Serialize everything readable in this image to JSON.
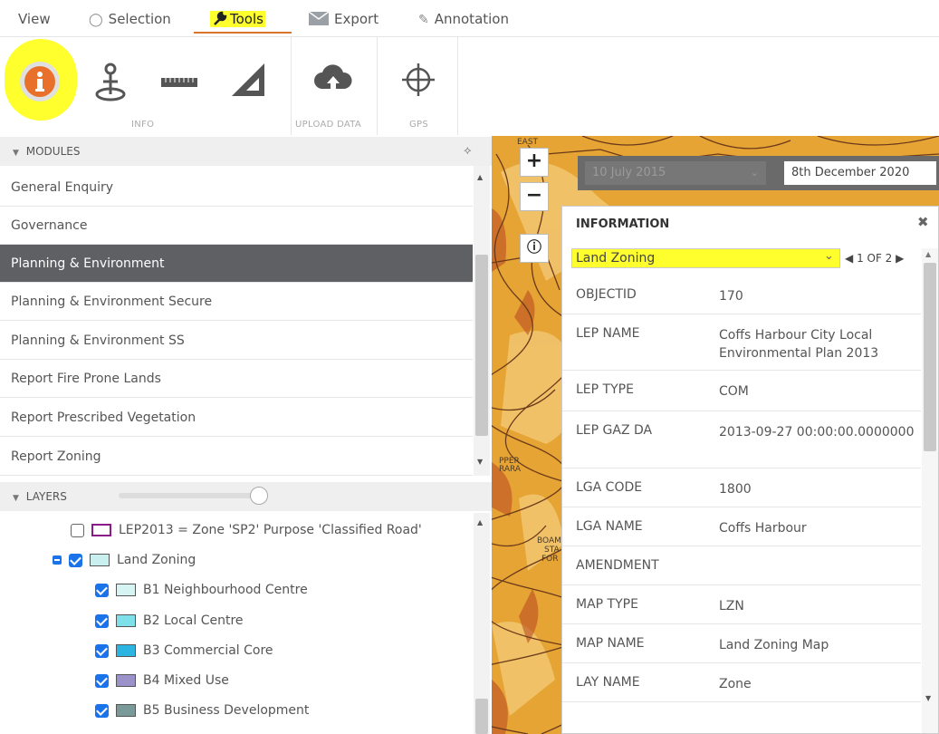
{
  "menu": {
    "view": "View",
    "selection": "Selection",
    "tools": "Tools",
    "export": "Export",
    "annotation": "Annotation"
  },
  "ribbon": {
    "info_label": "INFO",
    "upload_label": "UPLOAD DATA",
    "gps_label": "GPS"
  },
  "modules": {
    "header": "MODULES",
    "items": [
      "General Enquiry",
      "Governance",
      "Planning & Environment",
      "Planning & Environment Secure",
      "Planning & Environment SS",
      "Report Fire Prone Lands",
      "Report Prescribed Vegetation",
      "Report Zoning"
    ],
    "active": "Planning & Environment"
  },
  "layers": {
    "header": "LAYERS",
    "opacity_percent": 100,
    "items": [
      {
        "label": "LEP2013 = Zone 'SP2' Purpose 'Classified Road'",
        "checked": false,
        "swatch": "#ffffff",
        "border": "#8b1a8b"
      },
      {
        "label": "Land Zoning",
        "checked": true,
        "swatch": "#c9f0ee",
        "border": "#555555"
      },
      {
        "label": "B1 Neighbourhood Centre",
        "checked": true,
        "swatch": "#d6f5f2",
        "border": "#555555"
      },
      {
        "label": "B2 Local Centre",
        "checked": true,
        "swatch": "#7ee0e8",
        "border": "#555555"
      },
      {
        "label": "B3 Commercial Core",
        "checked": true,
        "swatch": "#2bb5e0",
        "border": "#555555"
      },
      {
        "label": "B4 Mixed Use",
        "checked": true,
        "swatch": "#9a92c8",
        "border": "#555555"
      },
      {
        "label": "B5 Business Development",
        "checked": true,
        "swatch": "#7a9a9a",
        "border": "#555555"
      }
    ]
  },
  "map": {
    "date_from": "10 July 2015",
    "date_to": "8th December 2020",
    "labels": [
      "EAST",
      "PPER",
      "RARA",
      "BOAM",
      "STA",
      "FOR"
    ]
  },
  "info_panel": {
    "title": "INFORMATION",
    "layer_select": "Land Zoning",
    "pager": "1 OF 2",
    "rows": [
      {
        "key": "OBJECTID",
        "value": "170"
      },
      {
        "key": "LEP NAME",
        "value": "Coffs Harbour City Local Environmental Plan 2013"
      },
      {
        "key": "LEP TYPE",
        "value": "COM"
      },
      {
        "key": "LEP GAZ DA",
        "value": "2013-09-27 00:00:00.0000000"
      },
      {
        "key": "LGA CODE",
        "value": "1800"
      },
      {
        "key": "LGA NAME",
        "value": "Coffs Harbour"
      },
      {
        "key": "AMENDMENT",
        "value": ""
      },
      {
        "key": "MAP TYPE",
        "value": "LZN"
      },
      {
        "key": "MAP NAME",
        "value": "Land Zoning Map"
      },
      {
        "key": "LAY NAME",
        "value": "Zone"
      }
    ]
  },
  "colors": {
    "highlight": "#ffff2e",
    "active_row": "#5e6064",
    "accent": "#d9742a",
    "checkbox": "#1a73e8",
    "map_base": "#e6a435"
  }
}
